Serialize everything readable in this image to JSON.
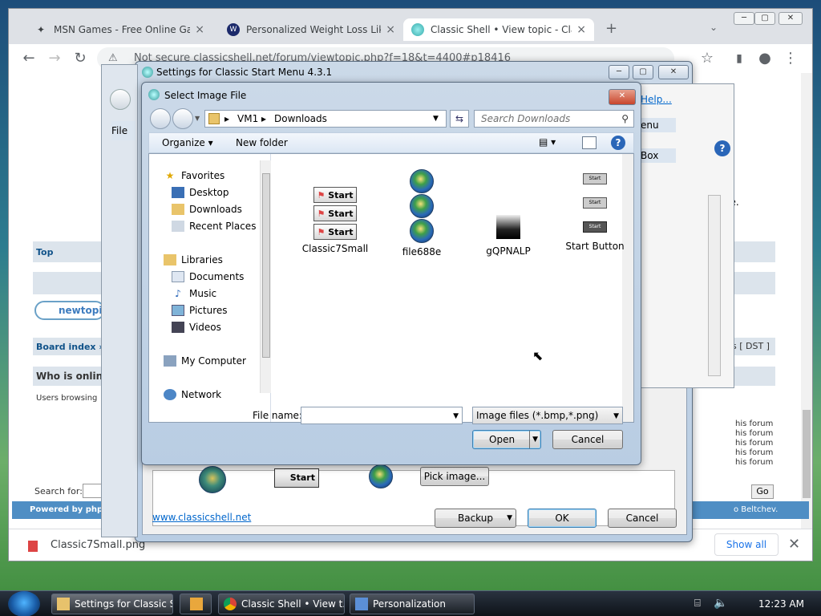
{
  "browser": {
    "tabs": [
      {
        "label": "MSN Games - Free Online Games",
        "icon": "msn-icon"
      },
      {
        "label": "Personalized Weight Loss Like Noom",
        "icon": "wunder-icon"
      },
      {
        "label": "Classic Shell • View topic - Classic",
        "icon": "classicshell-icon"
      }
    ],
    "address": "Not secure   classicshell.net/forum/viewtopic.php?f=18&t=4400#p18416",
    "forum": {
      "top_link": "Top",
      "new_topic": "newtopic",
      "board_index": "Board index »",
      "who_is_online": "Who is online",
      "users_browsing": "Users browsing",
      "search_for": "Search for:",
      "powered_by": "Powered by phpBB",
      "right_text_once": "once.",
      "right_help": "Help...",
      "right_menu": "enu",
      "right_box": "Box",
      "dst": "s [ DST ]",
      "forum_lines": [
        "his forum",
        "his forum",
        "his forum",
        "his forum",
        "his forum"
      ],
      "go": "Go",
      "beltchev": "o Beltchev."
    },
    "download": {
      "file": "Classic7Small.png",
      "show_all": "Show all"
    }
  },
  "settings_window": {
    "title": "Settings for Classic Start Menu 4.3.1",
    "file_menu": "File",
    "pick_image": "Pick image...",
    "start_label": "Start",
    "website": "www.classicshell.net",
    "backup": "Backup",
    "ok": "OK",
    "cancel": "Cancel"
  },
  "dialog": {
    "title": "Select Image File",
    "breadcrumb": [
      "VM1",
      "Downloads"
    ],
    "search_placeholder": "Search Downloads",
    "organize": "Organize",
    "new_folder": "New folder",
    "nav": {
      "favorites": "Favorites",
      "desktop": "Desktop",
      "downloads": "Downloads",
      "recent": "Recent Places",
      "libraries": "Libraries",
      "documents": "Documents",
      "music": "Music",
      "pictures": "Pictures",
      "videos": "Videos",
      "computer": "My Computer",
      "network": "Network"
    },
    "files": [
      "Classic7Small",
      "file688e",
      "gQPNALP",
      "Start Button"
    ],
    "start_text": "Start",
    "file_name_label": "File name:",
    "file_name_value": "",
    "file_type": "Image files (*.bmp,*.png)",
    "open": "Open",
    "cancel": "Cancel"
  },
  "taskbar": {
    "items": [
      "Settings for Classic S...",
      "",
      "Classic Shell • View t...",
      "Personalization"
    ],
    "time": "12:23 AM"
  }
}
